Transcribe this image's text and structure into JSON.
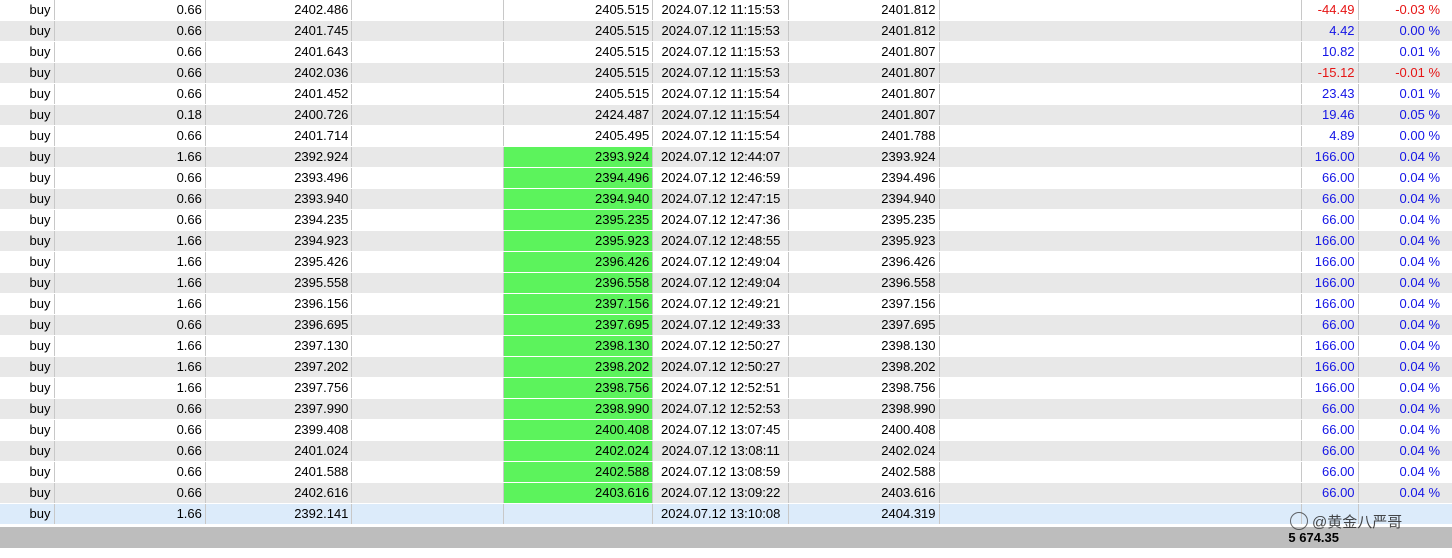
{
  "trade_rows": [
    {
      "type": "buy",
      "volume": "0.66",
      "price": "2402.486",
      "sl": "",
      "tp": "2405.515",
      "tp_hit": false,
      "time": "2024.07.12 11:15:53",
      "current": "2401.812",
      "profit": "-44.49",
      "percent": "-0.03 %",
      "sign": "neg",
      "shade": "odd"
    },
    {
      "type": "buy",
      "volume": "0.66",
      "price": "2401.745",
      "sl": "",
      "tp": "2405.515",
      "tp_hit": false,
      "time": "2024.07.12 11:15:53",
      "current": "2401.812",
      "profit": "4.42",
      "percent": "0.00 %",
      "sign": "pos",
      "shade": "even"
    },
    {
      "type": "buy",
      "volume": "0.66",
      "price": "2401.643",
      "sl": "",
      "tp": "2405.515",
      "tp_hit": false,
      "time": "2024.07.12 11:15:53",
      "current": "2401.807",
      "profit": "10.82",
      "percent": "0.01 %",
      "sign": "pos",
      "shade": "odd"
    },
    {
      "type": "buy",
      "volume": "0.66",
      "price": "2402.036",
      "sl": "",
      "tp": "2405.515",
      "tp_hit": false,
      "time": "2024.07.12 11:15:53",
      "current": "2401.807",
      "profit": "-15.12",
      "percent": "-0.01 %",
      "sign": "neg",
      "shade": "even"
    },
    {
      "type": "buy",
      "volume": "0.66",
      "price": "2401.452",
      "sl": "",
      "tp": "2405.515",
      "tp_hit": false,
      "time": "2024.07.12 11:15:54",
      "current": "2401.807",
      "profit": "23.43",
      "percent": "0.01 %",
      "sign": "pos",
      "shade": "odd"
    },
    {
      "type": "buy",
      "volume": "0.18",
      "price": "2400.726",
      "sl": "",
      "tp": "2424.487",
      "tp_hit": false,
      "time": "2024.07.12 11:15:54",
      "current": "2401.807",
      "profit": "19.46",
      "percent": "0.05 %",
      "sign": "pos",
      "shade": "even"
    },
    {
      "type": "buy",
      "volume": "0.66",
      "price": "2401.714",
      "sl": "",
      "tp": "2405.495",
      "tp_hit": false,
      "time": "2024.07.12 11:15:54",
      "current": "2401.788",
      "profit": "4.89",
      "percent": "0.00 %",
      "sign": "pos",
      "shade": "odd"
    },
    {
      "type": "buy",
      "volume": "1.66",
      "price": "2392.924",
      "sl": "",
      "tp": "2393.924",
      "tp_hit": true,
      "time": "2024.07.12 12:44:07",
      "current": "2393.924",
      "profit": "166.00",
      "percent": "0.04 %",
      "sign": "pos",
      "shade": "even"
    },
    {
      "type": "buy",
      "volume": "0.66",
      "price": "2393.496",
      "sl": "",
      "tp": "2394.496",
      "tp_hit": true,
      "time": "2024.07.12 12:46:59",
      "current": "2394.496",
      "profit": "66.00",
      "percent": "0.04 %",
      "sign": "pos",
      "shade": "odd"
    },
    {
      "type": "buy",
      "volume": "0.66",
      "price": "2393.940",
      "sl": "",
      "tp": "2394.940",
      "tp_hit": true,
      "time": "2024.07.12 12:47:15",
      "current": "2394.940",
      "profit": "66.00",
      "percent": "0.04 %",
      "sign": "pos",
      "shade": "even"
    },
    {
      "type": "buy",
      "volume": "0.66",
      "price": "2394.235",
      "sl": "",
      "tp": "2395.235",
      "tp_hit": true,
      "time": "2024.07.12 12:47:36",
      "current": "2395.235",
      "profit": "66.00",
      "percent": "0.04 %",
      "sign": "pos",
      "shade": "odd"
    },
    {
      "type": "buy",
      "volume": "1.66",
      "price": "2394.923",
      "sl": "",
      "tp": "2395.923",
      "tp_hit": true,
      "time": "2024.07.12 12:48:55",
      "current": "2395.923",
      "profit": "166.00",
      "percent": "0.04 %",
      "sign": "pos",
      "shade": "even"
    },
    {
      "type": "buy",
      "volume": "1.66",
      "price": "2395.426",
      "sl": "",
      "tp": "2396.426",
      "tp_hit": true,
      "time": "2024.07.12 12:49:04",
      "current": "2396.426",
      "profit": "166.00",
      "percent": "0.04 %",
      "sign": "pos",
      "shade": "odd"
    },
    {
      "type": "buy",
      "volume": "1.66",
      "price": "2395.558",
      "sl": "",
      "tp": "2396.558",
      "tp_hit": true,
      "time": "2024.07.12 12:49:04",
      "current": "2396.558",
      "profit": "166.00",
      "percent": "0.04 %",
      "sign": "pos",
      "shade": "even"
    },
    {
      "type": "buy",
      "volume": "1.66",
      "price": "2396.156",
      "sl": "",
      "tp": "2397.156",
      "tp_hit": true,
      "time": "2024.07.12 12:49:21",
      "current": "2397.156",
      "profit": "166.00",
      "percent": "0.04 %",
      "sign": "pos",
      "shade": "odd"
    },
    {
      "type": "buy",
      "volume": "0.66",
      "price": "2396.695",
      "sl": "",
      "tp": "2397.695",
      "tp_hit": true,
      "time": "2024.07.12 12:49:33",
      "current": "2397.695",
      "profit": "66.00",
      "percent": "0.04 %",
      "sign": "pos",
      "shade": "even"
    },
    {
      "type": "buy",
      "volume": "1.66",
      "price": "2397.130",
      "sl": "",
      "tp": "2398.130",
      "tp_hit": true,
      "time": "2024.07.12 12:50:27",
      "current": "2398.130",
      "profit": "166.00",
      "percent": "0.04 %",
      "sign": "pos",
      "shade": "odd"
    },
    {
      "type": "buy",
      "volume": "1.66",
      "price": "2397.202",
      "sl": "",
      "tp": "2398.202",
      "tp_hit": true,
      "time": "2024.07.12 12:50:27",
      "current": "2398.202",
      "profit": "166.00",
      "percent": "0.04 %",
      "sign": "pos",
      "shade": "even"
    },
    {
      "type": "buy",
      "volume": "1.66",
      "price": "2397.756",
      "sl": "",
      "tp": "2398.756",
      "tp_hit": true,
      "time": "2024.07.12 12:52:51",
      "current": "2398.756",
      "profit": "166.00",
      "percent": "0.04 %",
      "sign": "pos",
      "shade": "odd"
    },
    {
      "type": "buy",
      "volume": "0.66",
      "price": "2397.990",
      "sl": "",
      "tp": "2398.990",
      "tp_hit": true,
      "time": "2024.07.12 12:52:53",
      "current": "2398.990",
      "profit": "66.00",
      "percent": "0.04 %",
      "sign": "pos",
      "shade": "even"
    },
    {
      "type": "buy",
      "volume": "0.66",
      "price": "2399.408",
      "sl": "",
      "tp": "2400.408",
      "tp_hit": true,
      "time": "2024.07.12 13:07:45",
      "current": "2400.408",
      "profit": "66.00",
      "percent": "0.04 %",
      "sign": "pos",
      "shade": "odd"
    },
    {
      "type": "buy",
      "volume": "0.66",
      "price": "2401.024",
      "sl": "",
      "tp": "2402.024",
      "tp_hit": true,
      "time": "2024.07.12 13:08:11",
      "current": "2402.024",
      "profit": "66.00",
      "percent": "0.04 %",
      "sign": "pos",
      "shade": "even"
    },
    {
      "type": "buy",
      "volume": "0.66",
      "price": "2401.588",
      "sl": "",
      "tp": "2402.588",
      "tp_hit": true,
      "time": "2024.07.12 13:08:59",
      "current": "2402.588",
      "profit": "66.00",
      "percent": "0.04 %",
      "sign": "pos",
      "shade": "odd"
    },
    {
      "type": "buy",
      "volume": "0.66",
      "price": "2402.616",
      "sl": "",
      "tp": "2403.616",
      "tp_hit": true,
      "time": "2024.07.12 13:09:22",
      "current": "2403.616",
      "profit": "66.00",
      "percent": "0.04 %",
      "sign": "pos",
      "shade": "even"
    },
    {
      "type": "buy",
      "volume": "1.66",
      "price": "2392.141",
      "sl": "",
      "tp": "",
      "tp_hit": false,
      "time": "2024.07.12 13:10:08",
      "current": "2404.319",
      "profit": "",
      "percent": "",
      "sign": "pos",
      "shade": "sel"
    }
  ],
  "footer": {
    "total_profit": "5 674.35"
  },
  "colors": {
    "tp_hit": "#5cf35c",
    "profit_pos": "#1414e6",
    "profit_neg": "#e61414",
    "row_alt": "#e8e8e8",
    "row_selected": "#dcebfa",
    "footer_bg": "#bdbdbd"
  },
  "watermark": {
    "icon": "circle-logo-icon",
    "text": "@黄金八严哥"
  }
}
